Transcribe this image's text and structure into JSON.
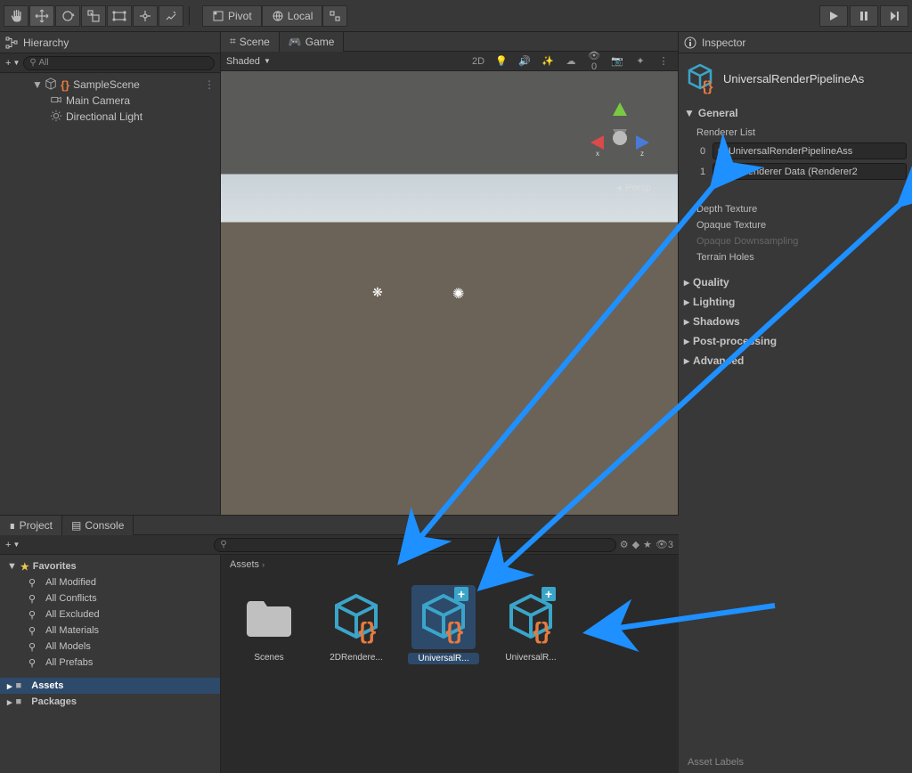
{
  "toolbar": {
    "pivot_label": "Pivot",
    "local_label": "Local"
  },
  "hierarchy": {
    "title": "Hierarchy",
    "search_placeholder": "All",
    "scene": "SampleScene",
    "items": [
      "Main Camera",
      "Directional Light"
    ]
  },
  "scene": {
    "tab_scene": "Scene",
    "tab_game": "Game",
    "shaded": "Shaded",
    "mode2d": "2D",
    "audio_count": "0",
    "persp": "Persp"
  },
  "project": {
    "tab_project": "Project",
    "tab_console": "Console",
    "fav": "Favorites",
    "fav_items": [
      "All Modified",
      "All Conflicts",
      "All Excluded",
      "All Materials",
      "All Models",
      "All Prefabs"
    ],
    "assets": "Assets",
    "packages": "Packages",
    "breadcrumb": "Assets",
    "assets_items": [
      {
        "name": "Scenes",
        "type": "folder"
      },
      {
        "name": "2DRendere...",
        "type": "asset"
      },
      {
        "name": "UniversalR...",
        "type": "asset_plus",
        "selected": true
      },
      {
        "name": "UniversalR...",
        "type": "asset_plus"
      }
    ],
    "count_badge": "3"
  },
  "inspector": {
    "title": "Inspector",
    "asset_name": "UniversalRenderPipelineAs",
    "section_general": "General",
    "renderer_list": "Renderer List",
    "renderers": [
      {
        "idx": "0",
        "name": "UniversalRenderPipelineAss"
      },
      {
        "idx": "1",
        "name": "2DRenderer Data (Renderer2"
      }
    ],
    "depth_texture": "Depth Texture",
    "opaque_texture": "Opaque Texture",
    "opaque_downsampling": "Opaque Downsampling",
    "terrain_holes": "Terrain Holes",
    "section_quality": "Quality",
    "section_lighting": "Lighting",
    "section_shadows": "Shadows",
    "section_post": "Post-processing",
    "section_advanced": "Advanced",
    "asset_labels": "Asset Labels"
  }
}
